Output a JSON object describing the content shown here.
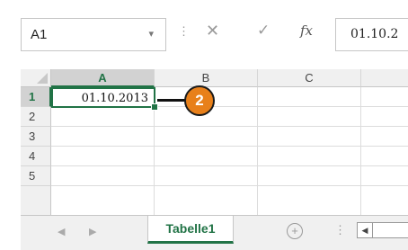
{
  "formula_bar": {
    "name_box": "A1",
    "dropdown_glyph": "▾",
    "dots": "⋮",
    "cancel_glyph": "✕",
    "enter_glyph": "✓",
    "fx_label": "fx",
    "formula_value": "01.10.2"
  },
  "grid": {
    "columns": [
      "A",
      "B",
      "C"
    ],
    "rows": [
      "1",
      "2",
      "3",
      "4",
      "5"
    ],
    "active_cell_value": "01.10.2013"
  },
  "callout": {
    "number": "2"
  },
  "tabs": {
    "prev_glyph": "◀",
    "next_glyph": "▶",
    "sheet": "Tabelle1",
    "add_glyph": "+",
    "dots": "⋮",
    "scroll_left_glyph": "◀"
  },
  "colors": {
    "accent": "#217346",
    "callout": "#e8801a"
  }
}
